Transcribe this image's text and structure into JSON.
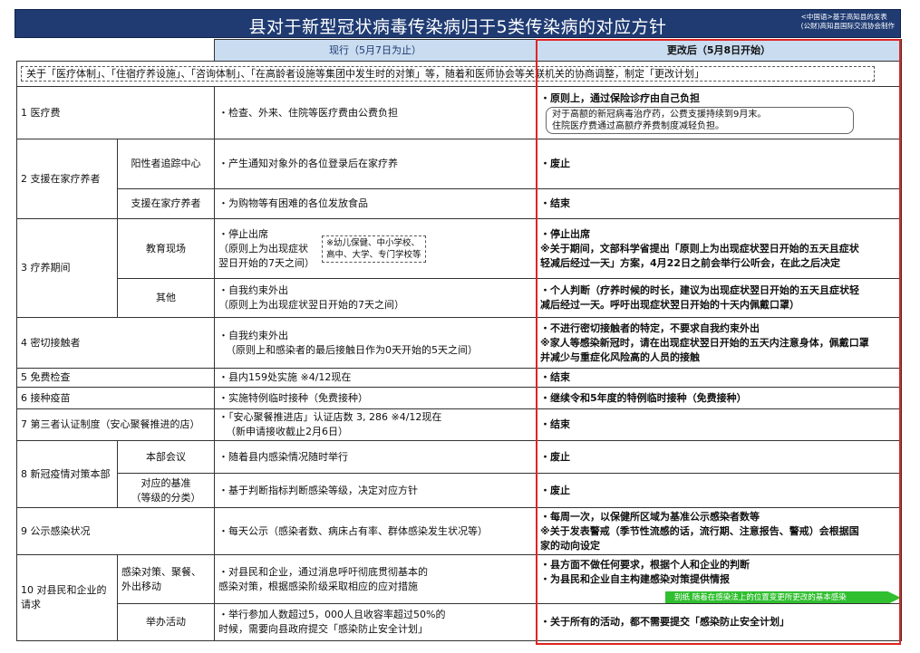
{
  "header": {
    "title": "县对于新型冠状病毒传染病归于5类传染病的对应方针",
    "source": [
      "<中国语>基于高知县的发表",
      "(公财)高知县国际交流协会制作"
    ]
  },
  "columns": {
    "current": "现行（5月7日为止）",
    "new": "更改后（5月8日开始）"
  },
  "intro": "关于「医疗体制」、「住宿疗养设施」、「咨询体制」、「在高龄者设施等集团中发生时的对策」等，随着和医师协会等关联机关的协商调整，制定「更改计划」",
  "rows": {
    "r1": {
      "cat": "1 医疗费",
      "cur": "・检查、外来、住院等医疗费由公费负担",
      "new1": "・原则上，通过保险诊疗由自己负担",
      "note": [
        "对于高额的新冠病毒治疗药，公费支援持续到9月末。",
        "住院医疗费通过高额疗养费制度减轻负担。"
      ]
    },
    "r2": {
      "cat": "2 支援在家疗养者",
      "sub1": "阳性者追踪中心",
      "cur1": "・产生通知对象外的各位登录后在家疗养",
      "new1": "・废止",
      "sub2": "支援在家疗养者",
      "cur2": "・为购物等有困难的各位发放食品",
      "new2": "・结束"
    },
    "r3": {
      "cat": "3 疗养期间",
      "sub1": "教育现场",
      "cur1": [
        "・停止出席",
        "（原则上为出现症状",
        "翌日开始的7天之间）"
      ],
      "box": [
        "※幼儿保健、中小学校、",
        "高中、大学、专门学校等"
      ],
      "new1": [
        "・停止出席",
        "※关于期间，文部科学省提出「原则上为出现症状翌日开始的五天且症状",
        "轻减后经过一天」方案，4月22日之前会举行公听会，在此之后决定"
      ],
      "sub2": "其他",
      "cur2": [
        "・自我约束外出",
        "（原则上为出现症状翌日开始的7天之间）"
      ],
      "new2": [
        "・个人判断（疗养时候的时长，建议为出现症状翌日开始的五天且症状轻",
        "减后经过一天。呼吁出现症状翌日开始的十天内佩戴口罩）"
      ]
    },
    "r4": {
      "cat": "4 密切接触者",
      "cur": [
        "・自我约束外出",
        "（原则上和感染者的最后接触日作为0天开始的5天之间）"
      ],
      "new": [
        "・不进行密切接触者的特定，不要求自我约束外出",
        "※家人等感染新冠时，请在出现症状翌日开始的五天内注意身体，佩戴口罩",
        "并减少与重症化风险高的人员的接触"
      ]
    },
    "r5": {
      "cat": "5 免费检查",
      "cur": "・县内159处实施 ※4/12现在",
      "new": "・结束"
    },
    "r6": {
      "cat": "6 接种疫苗",
      "cur": "・实施特例临时接种（免费接种）",
      "new": "・继续令和5年度的特例临时接种（免费接种）"
    },
    "r7": {
      "cat": "7 第三者认证制度（安心聚餐推进的店）",
      "cur": [
        "・「安心聚餐推进店」认证店数 3, 286 ※4/12现在",
        "（新申请接收截止2月6日）"
      ],
      "new": "・结束"
    },
    "r8": {
      "cat": "8 新冠疫情对策本部",
      "sub1": "本部会议",
      "cur1": "・随着县内感染情况随时举行",
      "new1": "・废止",
      "sub2": [
        "对应的基准",
        "（等级的分类）"
      ],
      "cur2": "・基于判断指标判断感染等级，决定对应方针",
      "new2": "・废止"
    },
    "r9": {
      "cat": "9 公示感染状况",
      "cur": "・每天公示（感染者数、病床占有率、群体感染发生状况等）",
      "new": [
        "・每周一次，以保健所区域为基准公示感染者数等",
        "※关于发表警戒（季节性流感的话，流行期、注意报告、警戒）会根据国",
        "家的动向设定"
      ]
    },
    "r10": {
      "cat": [
        "10 对县民和企业的",
        "请求"
      ],
      "sub1": [
        "感染对策、聚餐、",
        "外出移动"
      ],
      "cur1": [
        "・对县民和企业，通过消息呼吁彻底贯彻基本的",
        "感染对策，根据感染阶级采取相应的应对措施"
      ],
      "new1": [
        "・县方面不做任何要求，根据个人和企业的判断",
        "・为县民和企业自主构建感染对策提供情报"
      ],
      "arrow": "别纸 随着在感染法上的位置变更所更改的基本感染",
      "sub2": "举办活动",
      "cur2": [
        "・举行参加人数超过5，000人且收容率超过50%的",
        "时候，需要向县政府提交「感染防止安全计划」"
      ],
      "new2": "・关于所有的活动，都不需要提交「感染防止安全计划」"
    }
  }
}
